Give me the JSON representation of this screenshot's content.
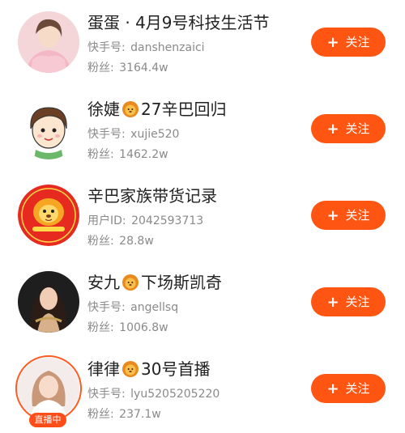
{
  "accounts": [
    {
      "name_before": "蛋蛋 · 4月9号科技生活节",
      "name_after": "",
      "has_lion": false,
      "id_label": "快手号",
      "id_value": "danshenzaici",
      "fans_label": "粉丝",
      "fans_value": "3164.4w",
      "follow_label": "关注",
      "live": false
    },
    {
      "name_before": "徐婕",
      "name_after": "27辛巴回归",
      "has_lion": true,
      "id_label": "快手号",
      "id_value": "xujie520",
      "fans_label": "粉丝",
      "fans_value": "1462.2w",
      "follow_label": "关注",
      "live": false
    },
    {
      "name_before": "辛巴家族带货记录",
      "name_after": "",
      "has_lion": false,
      "id_label": "用户ID",
      "id_value": "2042593713",
      "fans_label": "粉丝",
      "fans_value": "28.8w",
      "follow_label": "关注",
      "live": false
    },
    {
      "name_before": "安九",
      "name_after": "下场斯凯奇",
      "has_lion": true,
      "id_label": "快手号",
      "id_value": "angellsq",
      "fans_label": "粉丝",
      "fans_value": "1006.8w",
      "follow_label": "关注",
      "live": false
    },
    {
      "name_before": "律律",
      "name_after": "30号首播",
      "has_lion": true,
      "id_label": "快手号",
      "id_value": "lyu5205205220",
      "fans_label": "粉丝",
      "fans_value": "237.1w",
      "follow_label": "关注",
      "live": true,
      "live_label": "直播中"
    }
  ],
  "colors": {
    "follow_bg": "#ff5512",
    "live_accent": "#ff4d1a",
    "meta_text": "#8a8a8a",
    "name_text": "#222222"
  },
  "icons": {
    "follow": "plus-icon",
    "name_badge": "lion-emoji-icon"
  }
}
